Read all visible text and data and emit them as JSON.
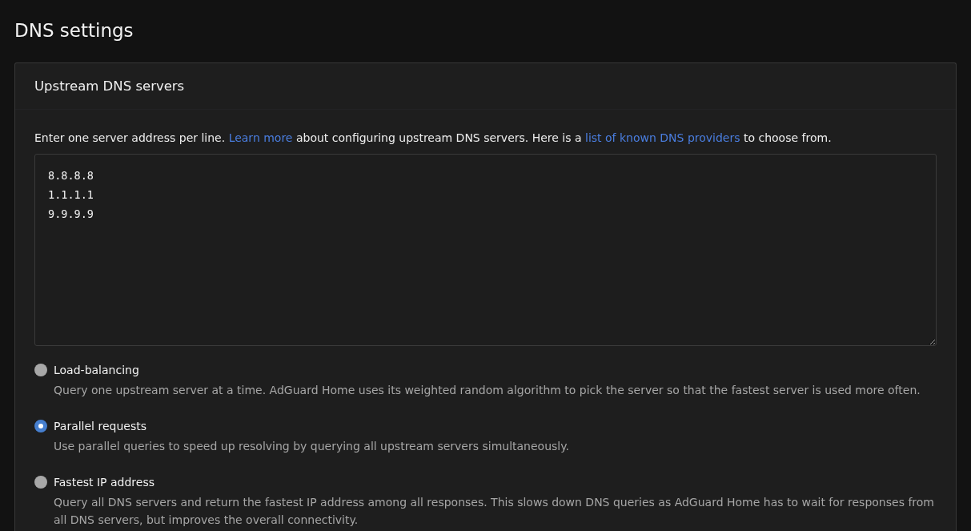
{
  "page_title": "DNS settings",
  "card": {
    "title": "Upstream DNS servers",
    "description": [
      {
        "kind": "text",
        "text": "Enter one server address per line. "
      },
      {
        "kind": "link",
        "text": "Learn more"
      },
      {
        "kind": "text",
        "text": " about configuring upstream DNS servers. Here is a "
      },
      {
        "kind": "link",
        "text": "list of known DNS providers"
      },
      {
        "kind": "text",
        "text": " to choose from."
      }
    ],
    "servers": "8.8.8.8\n1.1.1.1\n9.9.9.9",
    "modes": [
      {
        "label": "Load-balancing",
        "description": "Query one upstream server at a time. AdGuard Home uses its weighted random algorithm to pick the server so that the fastest server is used more often.",
        "selected": false
      },
      {
        "label": "Parallel requests",
        "description": "Use parallel queries to speed up resolving by querying all upstream servers simultaneously.",
        "selected": true
      },
      {
        "label": "Fastest IP address",
        "description": "Query all DNS servers and return the fastest IP address among all responses. This slows down DNS queries as AdGuard Home has to wait for responses from all DNS servers, but improves the overall connectivity.",
        "selected": false
      }
    ]
  }
}
